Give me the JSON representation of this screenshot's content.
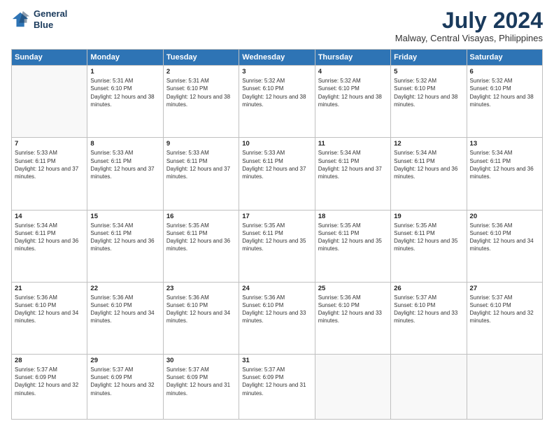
{
  "header": {
    "logo_line1": "General",
    "logo_line2": "Blue",
    "title": "July 2024",
    "subtitle": "Malway, Central Visayas, Philippines"
  },
  "calendar": {
    "days_of_week": [
      "Sunday",
      "Monday",
      "Tuesday",
      "Wednesday",
      "Thursday",
      "Friday",
      "Saturday"
    ],
    "weeks": [
      [
        {
          "day": "",
          "empty": true
        },
        {
          "day": "1",
          "sunrise": "5:31 AM",
          "sunset": "6:10 PM",
          "daylight": "12 hours and 38 minutes."
        },
        {
          "day": "2",
          "sunrise": "5:31 AM",
          "sunset": "6:10 PM",
          "daylight": "12 hours and 38 minutes."
        },
        {
          "day": "3",
          "sunrise": "5:32 AM",
          "sunset": "6:10 PM",
          "daylight": "12 hours and 38 minutes."
        },
        {
          "day": "4",
          "sunrise": "5:32 AM",
          "sunset": "6:10 PM",
          "daylight": "12 hours and 38 minutes."
        },
        {
          "day": "5",
          "sunrise": "5:32 AM",
          "sunset": "6:10 PM",
          "daylight": "12 hours and 38 minutes."
        },
        {
          "day": "6",
          "sunrise": "5:32 AM",
          "sunset": "6:10 PM",
          "daylight": "12 hours and 38 minutes."
        }
      ],
      [
        {
          "day": "7",
          "sunrise": "5:33 AM",
          "sunset": "6:11 PM",
          "daylight": "12 hours and 37 minutes."
        },
        {
          "day": "8",
          "sunrise": "5:33 AM",
          "sunset": "6:11 PM",
          "daylight": "12 hours and 37 minutes."
        },
        {
          "day": "9",
          "sunrise": "5:33 AM",
          "sunset": "6:11 PM",
          "daylight": "12 hours and 37 minutes."
        },
        {
          "day": "10",
          "sunrise": "5:33 AM",
          "sunset": "6:11 PM",
          "daylight": "12 hours and 37 minutes."
        },
        {
          "day": "11",
          "sunrise": "5:34 AM",
          "sunset": "6:11 PM",
          "daylight": "12 hours and 37 minutes."
        },
        {
          "day": "12",
          "sunrise": "5:34 AM",
          "sunset": "6:11 PM",
          "daylight": "12 hours and 36 minutes."
        },
        {
          "day": "13",
          "sunrise": "5:34 AM",
          "sunset": "6:11 PM",
          "daylight": "12 hours and 36 minutes."
        }
      ],
      [
        {
          "day": "14",
          "sunrise": "5:34 AM",
          "sunset": "6:11 PM",
          "daylight": "12 hours and 36 minutes."
        },
        {
          "day": "15",
          "sunrise": "5:34 AM",
          "sunset": "6:11 PM",
          "daylight": "12 hours and 36 minutes."
        },
        {
          "day": "16",
          "sunrise": "5:35 AM",
          "sunset": "6:11 PM",
          "daylight": "12 hours and 36 minutes."
        },
        {
          "day": "17",
          "sunrise": "5:35 AM",
          "sunset": "6:11 PM",
          "daylight": "12 hours and 35 minutes."
        },
        {
          "day": "18",
          "sunrise": "5:35 AM",
          "sunset": "6:11 PM",
          "daylight": "12 hours and 35 minutes."
        },
        {
          "day": "19",
          "sunrise": "5:35 AM",
          "sunset": "6:11 PM",
          "daylight": "12 hours and 35 minutes."
        },
        {
          "day": "20",
          "sunrise": "5:36 AM",
          "sunset": "6:10 PM",
          "daylight": "12 hours and 34 minutes."
        }
      ],
      [
        {
          "day": "21",
          "sunrise": "5:36 AM",
          "sunset": "6:10 PM",
          "daylight": "12 hours and 34 minutes."
        },
        {
          "day": "22",
          "sunrise": "5:36 AM",
          "sunset": "6:10 PM",
          "daylight": "12 hours and 34 minutes."
        },
        {
          "day": "23",
          "sunrise": "5:36 AM",
          "sunset": "6:10 PM",
          "daylight": "12 hours and 34 minutes."
        },
        {
          "day": "24",
          "sunrise": "5:36 AM",
          "sunset": "6:10 PM",
          "daylight": "12 hours and 33 minutes."
        },
        {
          "day": "25",
          "sunrise": "5:36 AM",
          "sunset": "6:10 PM",
          "daylight": "12 hours and 33 minutes."
        },
        {
          "day": "26",
          "sunrise": "5:37 AM",
          "sunset": "6:10 PM",
          "daylight": "12 hours and 33 minutes."
        },
        {
          "day": "27",
          "sunrise": "5:37 AM",
          "sunset": "6:10 PM",
          "daylight": "12 hours and 32 minutes."
        }
      ],
      [
        {
          "day": "28",
          "sunrise": "5:37 AM",
          "sunset": "6:09 PM",
          "daylight": "12 hours and 32 minutes."
        },
        {
          "day": "29",
          "sunrise": "5:37 AM",
          "sunset": "6:09 PM",
          "daylight": "12 hours and 32 minutes."
        },
        {
          "day": "30",
          "sunrise": "5:37 AM",
          "sunset": "6:09 PM",
          "daylight": "12 hours and 31 minutes."
        },
        {
          "day": "31",
          "sunrise": "5:37 AM",
          "sunset": "6:09 PM",
          "daylight": "12 hours and 31 minutes."
        },
        {
          "day": "",
          "empty": true
        },
        {
          "day": "",
          "empty": true
        },
        {
          "day": "",
          "empty": true
        }
      ]
    ]
  }
}
